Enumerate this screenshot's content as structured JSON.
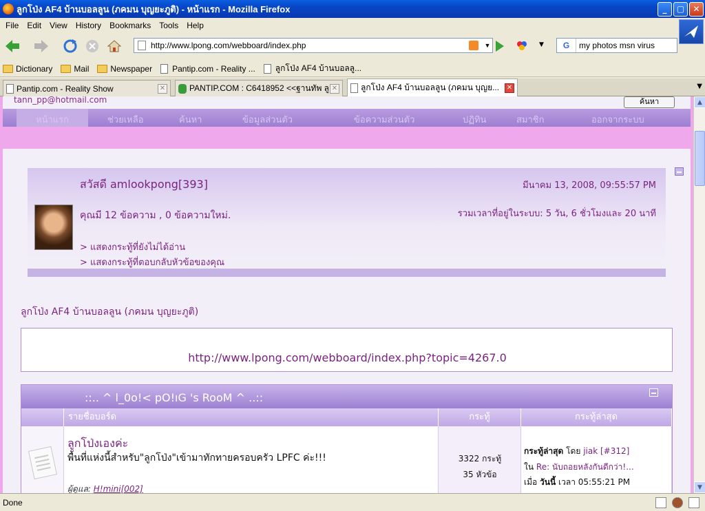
{
  "window": {
    "title": "ลูกโป่ง AF4 บ้านบอลลูน (ภคมน บุญยะภูติ) - หน้าแรก - Mozilla Firefox",
    "minimize": "_",
    "maximize": "▢",
    "close": "✕"
  },
  "menu": [
    "File",
    "Edit",
    "View",
    "History",
    "Bookmarks",
    "Tools",
    "Help"
  ],
  "nav": {
    "url": "http://www.lpong.com/webboard/index.php",
    "search_engine": "G",
    "search_query": "my photos msn virus"
  },
  "bookmarks": [
    "Dictionary",
    "Mail",
    "Newspaper",
    "Pantip.com - Reality ...",
    "ลูกโป่ง AF4 บ้านบอลลู..."
  ],
  "tabs": [
    {
      "title": "Pantip.com - Reality Show",
      "active": false
    },
    {
      "title": "PANTIP.COM : C6418952 <<ฐานทัพ ลู...",
      "active": false
    },
    {
      "title": "ลูกโป่ง AF4 บ้านบอลลูน (ภคมน บุญย...",
      "active": true
    }
  ],
  "page": {
    "email": "tann_pp@hotmail.com",
    "search_button": "ค้นหา",
    "nav_links": [
      "หน้าแรก",
      "ช่วยเหลือ",
      "ค้นหา",
      "ข้อมูลส่วนตัว",
      "ข้อความส่วนตัว",
      "ปฏิทิน",
      "สมาชิก",
      "ออกจากระบบ"
    ],
    "welcome": {
      "greeting": "สวัสดี amlookpong[393]",
      "date": "มีนาคม 13, 2008, 09:55:57 PM",
      "posts": "คุณมี 12 ข้อความ , 0 ข้อความใหม่.",
      "online": "รวมเวลาที่อยู่ในระบบ: 5 วัน, 6 ชั่วโมงและ 20 นาที",
      "link_unread": "> แสดงกระทู้ที่ยังไม่ได้อ่าน",
      "link_replies": "> แสดงกระทู้ที่ตอบกลับหัวข้อของคุณ"
    },
    "crumb": "ลูกโป่ง AF4 บ้านบอลลูน (ภคมน บุญยะภูติ)",
    "topic_url": "http://www.lpong.com/webboard/index.php?topic=4267.0",
    "board": {
      "header": "::.. ^ l_0o!< pO!ıG 's RooM ^ ..::",
      "col_boards": "รายชื่อบอร์ด",
      "col_topics": "กระทู้",
      "col_last": "กระทู้ล่าสุด",
      "name": "ลูกโป่งเองค่ะ",
      "desc": "พื้นที่แห่งนี้สำหรับ\"ลูกโป่ง\"เข้ามาทักทายครอบครัว LPFC ค่ะ!!!",
      "mod_label": "ผู้ดูแล:",
      "mod_name": "H!mini[002]",
      "stat_posts": "3322 กระทู้",
      "stat_topics": "35 หัวข้อ",
      "last_label": "กระทู้ล่าสุด",
      "last_by": "โดย",
      "last_user": "jiak [#312]",
      "last_in": "ใน",
      "last_topic": "Re: นับถอยหลังกันดีกว่า!...",
      "last_when": "เมื่อ",
      "last_today": "วันนี้",
      "last_time": "เวลา 05:55:21 PM"
    }
  },
  "status": "Done"
}
